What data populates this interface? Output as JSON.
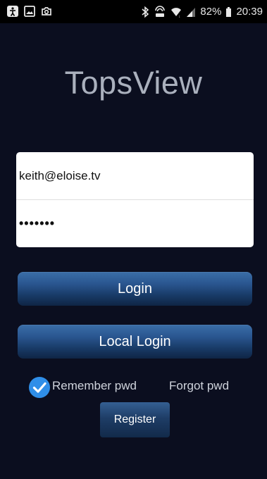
{
  "status_bar": {
    "battery_percent": "82%",
    "time": "20:39",
    "icons": [
      "accessibility-icon",
      "gallery-icon",
      "camera-icon",
      "bluetooth-icon",
      "hotspot-icon",
      "wifi-icon",
      "signal-icon",
      "battery-icon"
    ]
  },
  "app": {
    "title": "TopsView"
  },
  "form": {
    "username_value": "keith@eloise.tv",
    "password_mask": "•••••••"
  },
  "buttons": {
    "login_label": "Login",
    "local_login_label": "Local Login",
    "register_label": "Register"
  },
  "options": {
    "remember_label": "Remember pwd",
    "remember_checked": true,
    "forgot_label": "Forgot pwd"
  },
  "colors": {
    "background": "#0b0e1f",
    "title": "#aab0bd",
    "button_top": "#3b6ea8",
    "button_bottom": "#0f2545",
    "checkbox": "#2f8ee8"
  }
}
